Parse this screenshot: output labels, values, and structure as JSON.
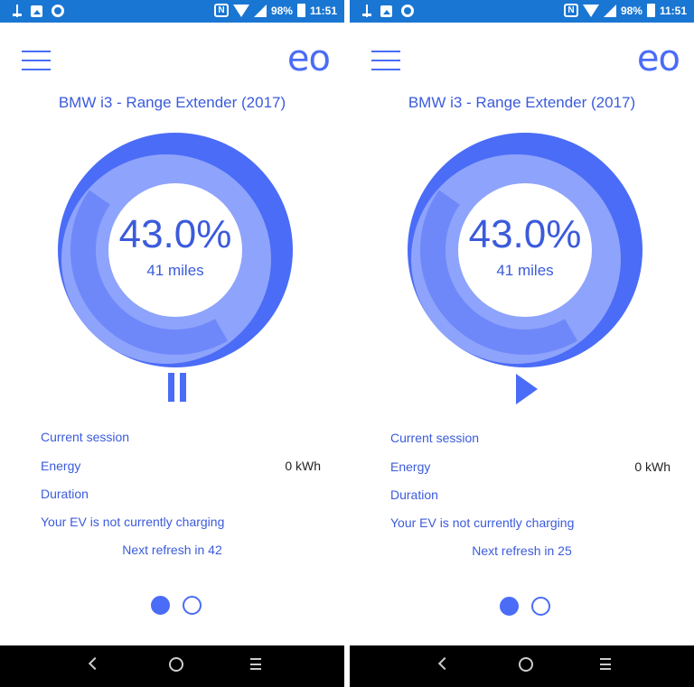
{
  "colors": {
    "status_bar": "#1976d2",
    "accent": "#4a6cf7",
    "text_blue": "#3b5bdb",
    "nav_bar": "#000000"
  },
  "screens": [
    {
      "status": {
        "battery": "98%",
        "time": "11:51",
        "nfc": "N"
      },
      "brand": "eo",
      "vehicle": "BMW i3 - Range Extender (2017)",
      "charge_level": 0.43,
      "percent_label": "43.0%",
      "range_label": "41 miles",
      "control": "pause",
      "session": {
        "title": "Current session",
        "energy_label": "Energy",
        "energy_value": "0 kWh",
        "duration_label": "Duration",
        "status_message": "Your EV is not currently charging"
      },
      "refresh_text": "Next refresh in 42",
      "page_indicator": {
        "current": 1,
        "total": 2
      }
    },
    {
      "status": {
        "battery": "98%",
        "time": "11:51",
        "nfc": "N"
      },
      "brand": "eo",
      "vehicle": "BMW i3 - Range Extender (2017)",
      "charge_level": 0.43,
      "percent_label": "43.0%",
      "range_label": "41 miles",
      "control": "play",
      "session": {
        "title": "Current session",
        "energy_label": "Energy",
        "energy_value": "0 kWh",
        "duration_label": "Duration",
        "status_message": "Your EV is not currently charging"
      },
      "refresh_text": "Next refresh in 25",
      "page_indicator": {
        "current": 1,
        "total": 2
      }
    }
  ]
}
